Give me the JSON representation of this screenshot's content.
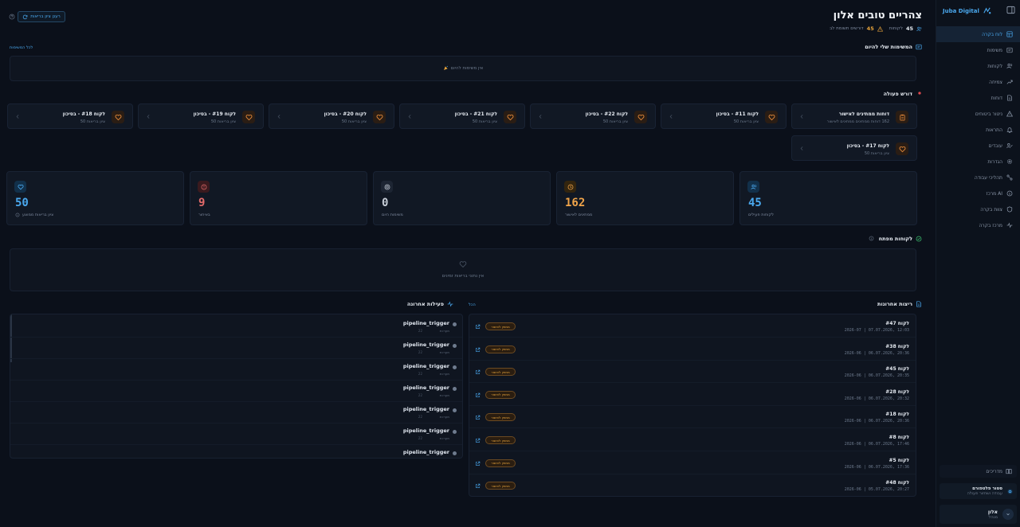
{
  "sidebar": {
    "brand": "Juba Digital",
    "items": [
      {
        "label": "לוח בקרה",
        "icon": "dashboard-icon",
        "active": true
      },
      {
        "label": "משימות",
        "icon": "tasks-icon"
      },
      {
        "label": "לקוחות",
        "icon": "users-icon"
      },
      {
        "label": "צמיחה",
        "icon": "growth-icon"
      },
      {
        "label": "דוחות",
        "icon": "reports-icon"
      },
      {
        "label": "ניטור ביטוחים",
        "icon": "monitor-icon"
      },
      {
        "label": "התראות",
        "icon": "bell-icon"
      },
      {
        "label": "עובדים",
        "icon": "employees-icon"
      },
      {
        "label": "הגדרות",
        "icon": "settings-icon"
      },
      {
        "label": "תהליכי עבודה",
        "icon": "workflow-icon"
      },
      {
        "label": "מרכז AI",
        "icon": "ai-icon"
      },
      {
        "label": "צוות בקרה",
        "icon": "shield-icon"
      },
      {
        "label": "מרכז בקרה",
        "icon": "activity-icon"
      }
    ],
    "guides": "מדריכים",
    "status_title": "סטור פלטפורם",
    "status_sub": "עבודה ושחזור פעולה",
    "user_name": "אלון",
    "user_role": "מנהל"
  },
  "header": {
    "title": "צהריים טובים אלון",
    "clients_count": "45",
    "clients_label": "לקוחות",
    "alerts_count": "45",
    "alerts_label": "דורשים תשומת לב",
    "refresh_label": "רענן ציון בריאות"
  },
  "tasks_section": {
    "title": "המשימות שלי להיום",
    "link": "לכל המשימות",
    "empty": "אין משימות להיום"
  },
  "action_section": {
    "title": "דורש פעולה",
    "cards": [
      {
        "title": "דוחות ממתינים לאישור",
        "sub": "162 דוחות ממתינים ממתינים לאישור",
        "icon": "clipboard-icon"
      },
      {
        "title": "לקוח #11 - בסיכון",
        "sub": "ציון בריאות 50",
        "icon": "heart-icon"
      },
      {
        "title": "לקוח #22 - בסיכון",
        "sub": "ציון בריאות 50",
        "icon": "heart-icon"
      },
      {
        "title": "לקוח #21 - בסיכון",
        "sub": "ציון בריאות 50",
        "icon": "heart-icon"
      },
      {
        "title": "לקוח #20 - בסיכון",
        "sub": "ציון בריאות 50",
        "icon": "heart-icon"
      },
      {
        "title": "לקוח #19 - בסיכון",
        "sub": "ציון בריאות 50",
        "icon": "heart-icon"
      },
      {
        "title": "לקוח #18 - בסיכון",
        "sub": "ציון בריאות 50",
        "icon": "heart-icon"
      },
      {
        "title": "לקוח #17 - בסיכון",
        "sub": "ציון בריאות 50",
        "icon": "heart-icon"
      }
    ]
  },
  "stats": [
    {
      "value": "45",
      "label": "לקוחות פעילים",
      "color": "#4aa8ee",
      "icon": "users-icon",
      "bg": "#12304a"
    },
    {
      "value": "162",
      "label": "ממתינים לאישור",
      "color": "#f0a44a",
      "icon": "clock-icon",
      "bg": "#33250f"
    },
    {
      "value": "0",
      "label": "משימות היום",
      "color": "#c5ccd6",
      "icon": "target-icon",
      "bg": "#1d2533"
    },
    {
      "value": "9",
      "label": "באיחור",
      "color": "#e26a6a",
      "icon": "alert-icon",
      "bg": "#3a1a1e"
    },
    {
      "value": "50",
      "label": "ציון בריאות ממוצע",
      "color": "#4aa8ee",
      "icon": "heart-icon",
      "bg": "#12304a"
    }
  ],
  "key_clients": {
    "title": "לקוחות מפתח",
    "empty": "אין נתוני בריאות זמינים"
  },
  "reports": {
    "title": "ריצות אחרונות",
    "link": "הכל",
    "badge": "ממתין לאישור",
    "rows": [
      {
        "title": "לקוח #47",
        "date": "2026-07 | 07.07.2026, 12:03"
      },
      {
        "title": "לקוח #38",
        "date": "2026-06 | 06.07.2026, 20:36"
      },
      {
        "title": "לקוח #45",
        "date": "2026-06 | 06.07.2026, 20:35"
      },
      {
        "title": "לקוח #28",
        "date": "2026-06 | 06.07.2026, 20:32"
      },
      {
        "title": "לקוח #18",
        "date": "2026-06 | 06.07.2026, 20:36"
      },
      {
        "title": "לקוח #8",
        "date": "2026-06 | 06.07.2026, 17:46"
      },
      {
        "title": "לקוח #5",
        "date": "2026-06 | 06.07.2026, 17:36"
      },
      {
        "title": "לקוח #48",
        "date": "2026-06 | 05.07.2026, 20:27"
      }
    ]
  },
  "activity": {
    "title": "פעילות אחרונה",
    "rows": [
      {
        "name": "pipeline_trigger",
        "sub": "מערכת",
        "ago": "22"
      },
      {
        "name": "pipeline_trigger",
        "sub": "מערכת",
        "ago": "22"
      },
      {
        "name": "pipeline_trigger",
        "sub": "מערכת",
        "ago": "22"
      },
      {
        "name": "pipeline_trigger",
        "sub": "מערכת",
        "ago": "22"
      },
      {
        "name": "pipeline_trigger",
        "sub": "מערכת",
        "ago": "22"
      },
      {
        "name": "pipeline_trigger",
        "sub": "מערכת",
        "ago": "22"
      },
      {
        "name": "pipeline_trigger",
        "sub": "",
        "ago": ""
      }
    ]
  }
}
